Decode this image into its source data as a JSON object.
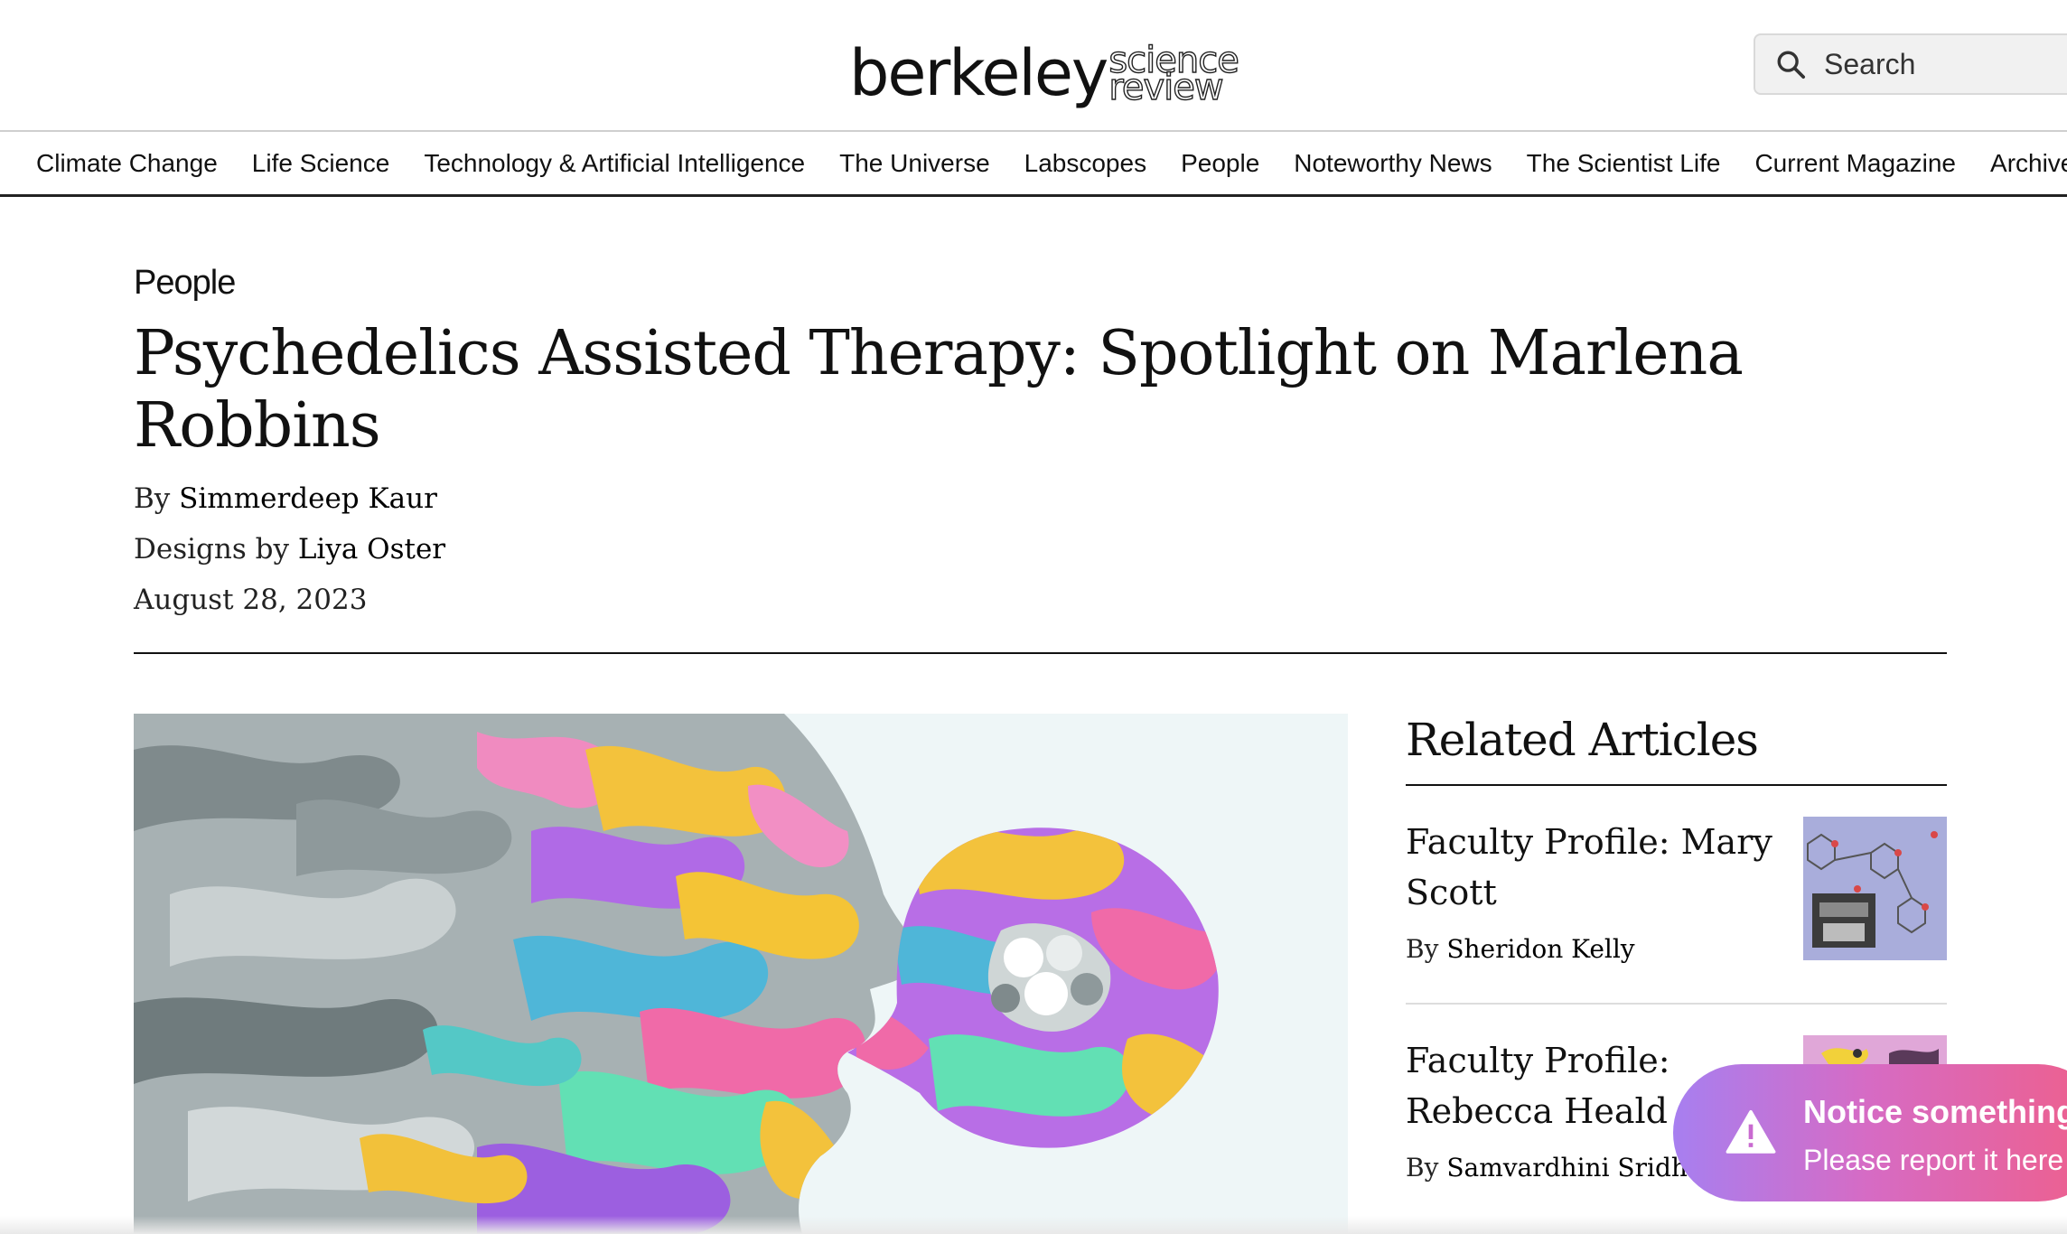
{
  "header": {
    "logo_main": "berkeley",
    "logo_sub1": "science",
    "logo_sub2": "review",
    "search_placeholder": "Search",
    "search_icon": "search-icon"
  },
  "nav": {
    "items": [
      "Climate Change",
      "Life Science",
      "Technology & Artificial Intelligence",
      "The Universe",
      "Labscopes",
      "People",
      "Noteworthy News",
      "The Scientist Life",
      "Current Magazine",
      "Archive"
    ]
  },
  "article": {
    "category": "People",
    "title": "Psychedelics Assisted Therapy: Spotlight on Marlena Robbins",
    "by_label": "By",
    "author": "Simmerdeep Kaur",
    "designs_label": "Designs by",
    "designer": "Liya Oster",
    "date": "August 28, 2023"
  },
  "related": {
    "heading": "Related Articles",
    "items": [
      {
        "title": "Faculty Profile: Mary Scott",
        "by_label": "By",
        "author": "Sheridon Kelly"
      },
      {
        "title": "Faculty Profile: Rebecca Heald",
        "by_label": "By",
        "author": "Samvardhini Sridharan"
      }
    ]
  },
  "notice": {
    "title": "Notice something",
    "subtitle": "Please report it here",
    "icon": "warning-icon"
  },
  "colors": {
    "text": "#111111",
    "notice_gradient_start": "#a77ff0",
    "notice_gradient_end": "#ef5f8a",
    "search_bg": "#f1f1f1"
  }
}
